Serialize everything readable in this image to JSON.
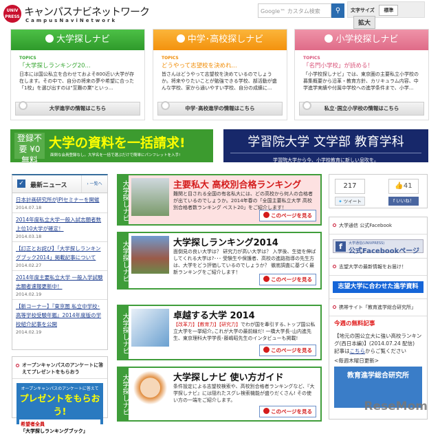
{
  "header": {
    "logo_badge": "UNIV PRESS",
    "logo_title": "キャンパスナビネットワーク",
    "logo_sub": "CampusNaviNetwork",
    "search_placeholder": "Google™ カスタム検索",
    "search_icon": "search-icon",
    "font_size_label": "文字サイズ",
    "font_standard": "標準",
    "font_large": "拡大"
  },
  "cards": [
    {
      "title": "大学探しナビ",
      "topics": "TOPICS",
      "topic_title": "「大学探しランキング20...",
      "body": "日本には国公私立を合わせておよそ800近い大学が存在します。その中で、自分の将来の夢や希望に合った「1校」を選び出すのは\"至難の業\"といっ...",
      "button": "大学進学の情報はこちら",
      "color": "#3aa835"
    },
    {
      "title": "中学･高校探しナビ",
      "topics": "TOPICS",
      "topic_title": "どうやって志望校を決めれ...",
      "body": "皆さんはどうやって志望校を決めているのでしょうか。将来やりたいことが勉強できる学校、部活動が盛んな学校、家から通いやすい学校、自分の成績に...",
      "button": "中学･高校進学の情報はこちら",
      "color": "#f59a1a"
    },
    {
      "title": "小学校探しナビ",
      "topics": "TOPICS",
      "topic_title": "「名門小学校」が読める！",
      "body": "「小学校探しナビ」では、東京圏の主要私立小学校の募集概要から沿革・教育方針、カリキュラム内容、中学進学実績や付属中学校への進学条件まで、小学...",
      "button": "私立･国立小学校の情報はこちら",
      "color": "#e57a95"
    }
  ],
  "banners": {
    "left_badge": "登録不要 ¥0 無料",
    "left_title": "大学の資料を一括請求!",
    "left_sub": "面倒な会員登録なし。大学名を一括で選ぶだけで簡単にパンフレットを入手!",
    "right_title": "学習院大学 文学部 教育学科",
    "right_sub": "学習院大学から今、小学校教育に新しい息吹を。"
  },
  "news": {
    "title": "最新ニュース",
    "more": "一覧へ",
    "items": [
      {
        "title": "日本計画研究所がJPIセミナーを開催",
        "date": "2014.07.18"
      },
      {
        "title": "2014年度私立大学一般入試志願者数 上位10大学が確定！",
        "date": "2014.03.18"
      },
      {
        "title": "【訂正とお詫び】「大学探しランキングブック2014」掲載記事について",
        "date": "2014.02.27"
      },
      {
        "title": "2014年度主要私立大学 一般入学試験志願者速報更新中！",
        "date": "2014.02.19"
      },
      {
        "title": "【新コーナー】『東京圏 私立中学校･高等学校受験年鑑』2014年度版の学校紹介記事を公開",
        "date": "2014.02.19"
      }
    ]
  },
  "campaign": {
    "title": "オープンキャンパスのアンケートに答えてプレゼントをもらおう",
    "img_top": "オープンキャンパスのアンケートに答えて",
    "img_big": "プレゼントをもらおう!",
    "img_who": "希望者全員",
    "img_item": "「大学探しランキングブック」"
  },
  "articles": [
    {
      "label": "大学探しナビ",
      "title": "主要私大 高校別合格ランキング",
      "body": "難関と目される全国の有名私大には、どの高校から何人の合格者が出ているのでしょうか。2014年春の「全国主要私立大学 高校別合格者数ランキング ベスト20」をご紹介します！",
      "link": "このページを見る"
    },
    {
      "label": "大学探しナビ",
      "title": "大学探しランキング2014",
      "body": "面倒見の良い大学は？ 研究力が高い大学は？ 入学後、生徒を伸ばしてくれる大学は?･･･ 受験生や保護者、高校の進路指導の先生方は、大学をどう評価しているのでしょうか？ 徹底調査に基づく最新ランキングをご紹介します！",
      "link": "このページを見る"
    },
    {
      "label": "大学探しナビ",
      "title": "卓越する大学 2014",
      "tags": "【改革力】【教育力】【研究力】",
      "body": "でわが国を牽引する､トップ国公私立大学を一挙紹介｡これが大学の最前線だ! 一橋大学長･山内進先生、東京理科大学学長･藤嶋昭先生のインタビューも掲載!",
      "link": "このページを見る"
    },
    {
      "label": "大学探しナビ",
      "title": "大学探しナビ 使い方ガイド",
      "body": "条件設定による志望校検索や、高校別合格者ランキングなど、『大学探しナビ』には隠れたスグレ検索機能が盛りだくさん! その使い方の一端をご紹介します。",
      "link": "このページを見る"
    }
  ],
  "share": {
    "tweet_count": "217",
    "tweet": "ツイート",
    "like_count": "41",
    "like": "いいね！"
  },
  "side": {
    "fb_heading": "大学通信 公式Facebook",
    "fb_small": "大学通信(UNIVPRESS)",
    "fb_big": "公式Facebookページ",
    "info_heading": "志望大学の最新情報をお届け！",
    "info_button": "志望大学に合わせた進学資料",
    "mobile_heading": "携帯サイト「教育進学総合研究所」",
    "free_title": "今週の無料記事",
    "free_body": "【地元の国公立大に強い高校ランキング(西日本編)】(2014.07.24 配信)",
    "free_pre": "記事は",
    "free_link": "こちら",
    "free_post": "からご覧ください",
    "weekly": "<毎週木曜日更新>",
    "ad_title": "教育進学総合研究所"
  },
  "watermark": "ReseMom"
}
